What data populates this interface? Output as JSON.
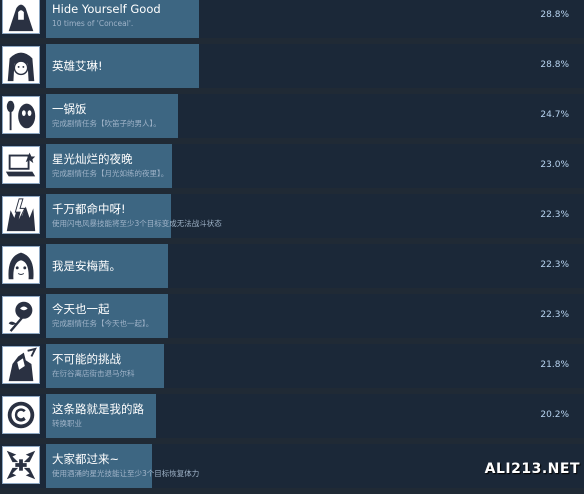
{
  "achievements": [
    {
      "title": "Hide Yourself Good",
      "desc": "10 times of 'Conceal'.",
      "percent": "28.8%",
      "icon": "hooded-figure-icon"
    },
    {
      "title": "英雄艾琳!",
      "desc": "",
      "percent": "28.8%",
      "icon": "girl-portrait-icon"
    },
    {
      "title": "一锅饭",
      "desc": "完成剧情任务【吹笛子的男人】。",
      "percent": "24.7%",
      "icon": "masked-man-spoon-icon"
    },
    {
      "title": "星光灿烂的夜晚",
      "desc": "完成剧情任务【月光如练的夜里】。",
      "percent": "23.0%",
      "icon": "laptop-icon"
    },
    {
      "title": "千万都命中呀!",
      "desc": "使用闪电风暴技能将至少3个目标变成无法战斗状态",
      "percent": "22.3%",
      "icon": "lightning-monsters-icon"
    },
    {
      "title": "我是安梅茜。",
      "desc": "",
      "percent": "22.3%",
      "icon": "girl-face-icon"
    },
    {
      "title": "今天也一起",
      "desc": "完成剧情任务【今天也一起】。",
      "percent": "22.3%",
      "icon": "rose-icon"
    },
    {
      "title": "不可能的挑战",
      "desc": "在衍谷离店街击退马尔科",
      "percent": "21.8%",
      "icon": "warrior-icon"
    },
    {
      "title": "这条路就是我的路",
      "desc": "转换职业",
      "percent": "20.2%",
      "icon": "class-change-icon"
    },
    {
      "title": "大家都过来~",
      "desc": "使用酒涌的星光技能让至少3个目标恢复体力",
      "percent": "",
      "icon": "heal-arrows-icon"
    }
  ],
  "bar_fill_fraction": [
    0.2885,
    0.2885,
    0.2265,
    0.2155,
    0.2135,
    0.2085,
    0.2085,
    0.2015,
    0.1925,
    0.1815
  ],
  "watermark": "ALI213.NET",
  "colors": {
    "background": "#1b2838",
    "bar": "#3d6682",
    "title": "#ffffff",
    "description": "#9fb3c8",
    "percent": "#b8d4f0"
  }
}
